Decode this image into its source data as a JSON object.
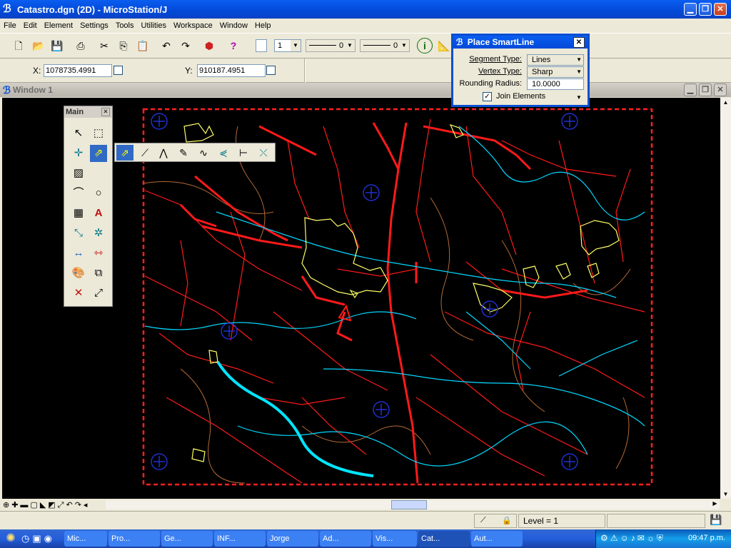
{
  "app": {
    "title": "Catastro.dgn (2D) - MicroStation/J",
    "icon": "microstation-icon"
  },
  "menubar": [
    "File",
    "Edit",
    "Element",
    "Settings",
    "Tools",
    "Utilities",
    "Workspace",
    "Window",
    "Help"
  ],
  "toolbar": {
    "level_value": "1",
    "style_value": "0",
    "weight_value": "0"
  },
  "coords": {
    "x_label": "X:",
    "x_value": "1078735.4991",
    "y_label": "Y:",
    "y_value": "910187.4951"
  },
  "view": {
    "title": "Window 1"
  },
  "main_palette": {
    "title": "Main"
  },
  "dialog": {
    "title": "Place SmartLine",
    "segment_type_label": "Segment Type:",
    "segment_type_value": "Lines",
    "vertex_type_label": "Vertex Type:",
    "vertex_type_value": "Sharp",
    "rounding_radius_label": "Rounding Radius:",
    "rounding_radius_value": "10.0000",
    "join_elements_label": "Join Elements",
    "join_elements_checked": true
  },
  "status": {
    "level_text": "Level = 1"
  },
  "taskbar": {
    "tasks": [
      "Mic...",
      "Pro...",
      "Ge...",
      "INF...",
      "Jorge",
      "Ad...",
      "Vis...",
      "Cat...",
      "Aut..."
    ],
    "active_index": 7,
    "clock": "09:47 p.m."
  },
  "colors": {
    "road": "#ff0000",
    "river": "#00e5ff",
    "parcel": "#ffff66",
    "contour": "#c87a3c",
    "marker": "#2030d0",
    "canvas": "#000000"
  }
}
